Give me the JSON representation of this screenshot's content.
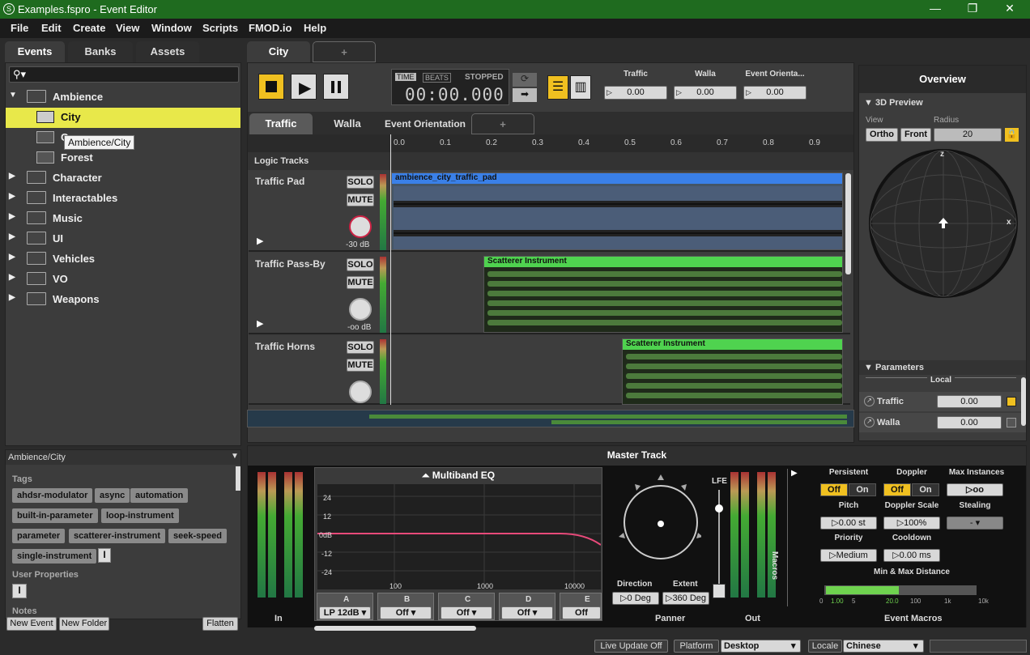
{
  "window": {
    "title": "Examples.fspro - Event Editor",
    "minimize": "—",
    "maximize": "❐",
    "close": "✕"
  },
  "menu": [
    "File",
    "Edit",
    "Create",
    "View",
    "Window",
    "Scripts",
    "FMOD.io",
    "Help"
  ],
  "left_tabs": [
    "Events",
    "Banks",
    "Assets"
  ],
  "search": {
    "icon": "search-icon"
  },
  "tree": [
    {
      "label": "Ambience",
      "type": "folder",
      "expanded": true
    },
    {
      "label": "City",
      "type": "event",
      "selected": true
    },
    {
      "label": "C",
      "type": "event"
    },
    {
      "label": "Forest",
      "type": "event"
    },
    {
      "label": "Character",
      "type": "folder"
    },
    {
      "label": "Interactables",
      "type": "folder"
    },
    {
      "label": "Music",
      "type": "folder"
    },
    {
      "label": "UI",
      "type": "folder"
    },
    {
      "label": "Vehicles",
      "type": "folder"
    },
    {
      "label": "VO",
      "type": "folder"
    },
    {
      "label": "Weapons",
      "type": "folder"
    }
  ],
  "tooltip": "Ambience/City",
  "info": {
    "path": "Ambience/City",
    "tags_heading": "Tags",
    "tags": [
      "ahdsr-modulator",
      "async",
      "automation",
      "built-in-parameter",
      "loop-instrument",
      "parameter",
      "scatterer-instrument",
      "seek-speed",
      "single-instrument"
    ],
    "user_props": "User Properties",
    "notes": "Notes"
  },
  "left_buttons": {
    "new_event": "New Event",
    "new_folder": "New Folder",
    "flatten": "Flatten"
  },
  "editor_tabs": [
    "City",
    "+"
  ],
  "transport": {
    "time": "TIME",
    "beats": "BEATS",
    "state": "STOPPED",
    "clock": "00:00.000"
  },
  "top_params": [
    {
      "name": "Traffic",
      "value": "0.00"
    },
    {
      "name": "Walla",
      "value": "0.00"
    },
    {
      "name": "Event Orienta...",
      "value": "0.00"
    }
  ],
  "sheet_tabs": [
    "Traffic",
    "Walla",
    "Event Orientation",
    "+"
  ],
  "ruler": [
    "0.0",
    "0.1",
    "0.2",
    "0.3",
    "0.4",
    "0.5",
    "0.6",
    "0.7",
    "0.8",
    "0.9"
  ],
  "logic_tracks": "Logic Tracks",
  "tracks": [
    {
      "name": "Traffic Pad",
      "solo": "SOLO",
      "mute": "MUTE",
      "vol": "-30 dB",
      "instrument": "ambience_city_traffic_pad"
    },
    {
      "name": "Traffic Pass-By",
      "solo": "SOLO",
      "mute": "MUTE",
      "vol": "-oo dB",
      "instrument": "Scatterer Instrument"
    },
    {
      "name": "Traffic Horns",
      "solo": "SOLO",
      "mute": "MUTE",
      "vol": "",
      "instrument": "Scatterer Instrument"
    }
  ],
  "overview": {
    "title": "Overview",
    "preview": "3D Preview",
    "view_label": "View",
    "radius_label": "Radius",
    "ortho": "Ortho",
    "front": "Front",
    "radius": "20",
    "axis_z": "z",
    "axis_x": "x",
    "parameters": "Parameters",
    "local": "Local",
    "params": [
      {
        "name": "Traffic",
        "value": "0.00"
      },
      {
        "name": "Walla",
        "value": "0.00"
      }
    ]
  },
  "master": {
    "title": "Master Track",
    "eq_title": "Multiband EQ",
    "db_ticks": [
      "24",
      "12",
      "0dB",
      "-12",
      "-24"
    ],
    "freq_ticks": [
      "100",
      "1000",
      "10000"
    ],
    "bands": [
      {
        "name": "A",
        "value": "LP 12dB"
      },
      {
        "name": "B",
        "value": "Off"
      },
      {
        "name": "C",
        "value": "Off"
      },
      {
        "name": "D",
        "value": "Off"
      },
      {
        "name": "E",
        "value": "Off"
      }
    ],
    "in_label": "In",
    "out_label": "Out",
    "panner": "Panner",
    "lfe": "LFE",
    "direction": "Direction",
    "extent": "Extent",
    "direction_val": "0 Deg",
    "extent_val": "360 Deg",
    "macros_side": "Macros"
  },
  "macros": {
    "persistent": "Persistent",
    "doppler": "Doppler",
    "max_instances": "Max Instances",
    "off": "Off",
    "on": "On",
    "max_val": "oo",
    "pitch": "Pitch",
    "pitch_val": "0.00 st",
    "doppler_scale": "Doppler Scale",
    "doppler_scale_val": "100%",
    "stealing": "Stealing",
    "stealing_val": "-",
    "priority": "Priority",
    "priority_val": "Medium",
    "cooldown": "Cooldown",
    "cooldown_val": "0.00 ms",
    "minmax": "Min & Max Distance",
    "scale": [
      "0",
      "1.00",
      "5",
      "20.0",
      "100",
      "1k",
      "10k"
    ],
    "title": "Event Macros"
  },
  "statusbar": {
    "live_update": "Live Update Off",
    "platform_label": "Platform",
    "platform": "Desktop",
    "locale_label": "Locale",
    "locale": "Chinese"
  },
  "colors": {
    "accent_green": "#1f6b1f",
    "selection_yellow": "#e8e84a",
    "play_yellow": "#f0c020"
  }
}
